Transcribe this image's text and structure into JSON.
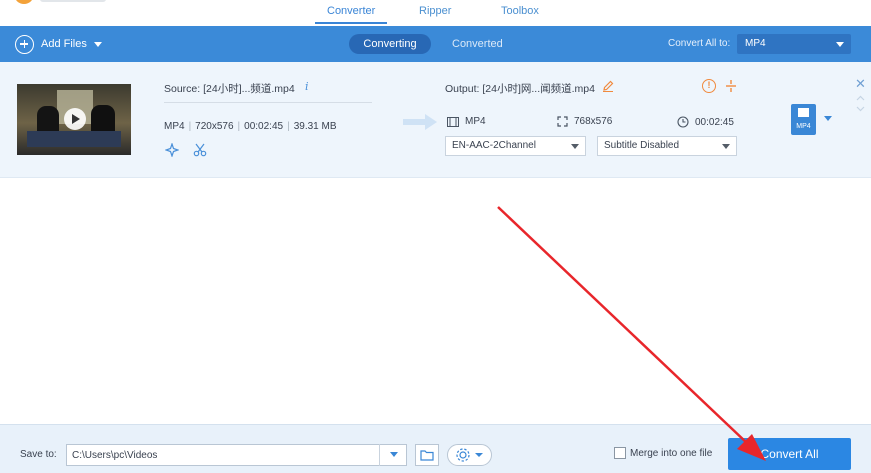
{
  "nav": {
    "tabs": [
      "Converter",
      "Ripper",
      "Toolbox"
    ],
    "active_index": 0
  },
  "toolbar": {
    "add_files_label": "Add Files",
    "tab_converting": "Converting",
    "tab_converted": "Converted",
    "convert_all_to_label": "Convert All to:",
    "convert_all_format": "MP4"
  },
  "file": {
    "source_label": "Source: [24小时]...频道.mp4",
    "format": "MP4",
    "resolution": "720x576",
    "duration": "00:02:45",
    "size": "39.31 MB",
    "output_label": "Output: [24小时]网...闻频道.mp4",
    "out_format": "MP4",
    "out_resolution": "768x576",
    "out_duration": "00:02:45",
    "audio_track": "EN-AAC-2Channel",
    "subtitle": "Subtitle Disabled",
    "badge_format": "MP4"
  },
  "bottom": {
    "save_to_label": "Save to:",
    "save_path": "C:\\Users\\pc\\Videos",
    "merge_label": "Merge into one file",
    "merge_checked": false,
    "convert_all_button": "Convert All"
  },
  "colors": {
    "accent": "#3b8ad8",
    "annotation_arrow": "#e8262b",
    "warning": "#f08a3e"
  },
  "icons": [
    "plus-circle-icon",
    "info-icon",
    "cut-icon",
    "enhance-icon",
    "arrow-right-icon",
    "edit-icon",
    "warning-icon",
    "split-icon",
    "film-icon",
    "resize-icon",
    "clock-icon",
    "close-icon",
    "chevron-up-icon",
    "chevron-down-icon",
    "folder-icon",
    "gear-icon",
    "red-arrow-annotation"
  ]
}
